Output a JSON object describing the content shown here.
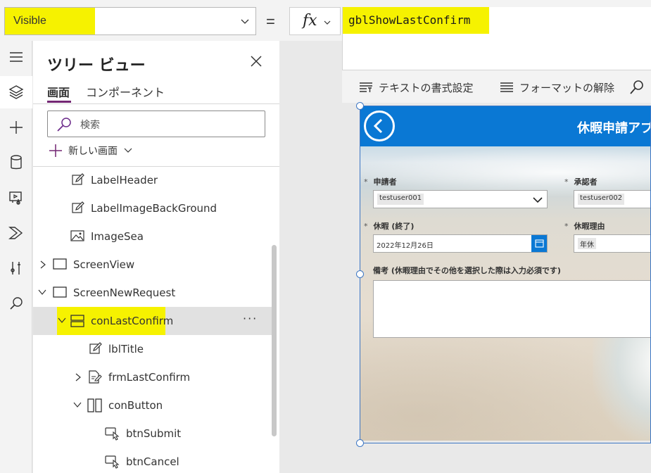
{
  "formula_bar": {
    "property": "Visible",
    "equals": "=",
    "fx": "fx",
    "formula": "gblShowLastConfirm"
  },
  "format_toolbar": {
    "text_format": "テキストの書式設定",
    "remove_format": "フォーマットの解除"
  },
  "rail": {
    "icons": [
      "hamburger-icon",
      "layers-icon",
      "plus-icon",
      "data-icon",
      "media-icon",
      "power-automate-icon",
      "tools-icon",
      "search-icon"
    ]
  },
  "tree": {
    "title": "ツリー ビュー",
    "tabs": [
      {
        "label": "画面",
        "active": true
      },
      {
        "label": "コンポーネント",
        "active": false
      }
    ],
    "search_placeholder": "検索",
    "new_screen": "新しい画面",
    "nodes": [
      {
        "label": "LabelHeader",
        "icon": "label-icon"
      },
      {
        "label": "LabelImageBackGround",
        "icon": "label-icon"
      },
      {
        "label": "ImageSea",
        "icon": "image-icon"
      },
      {
        "label": "ScreenView",
        "icon": "screen-icon",
        "expander": "collapsed"
      },
      {
        "label": "ScreenNewRequest",
        "icon": "screen-icon",
        "expander": "expanded"
      },
      {
        "label": "conLastConfirm",
        "icon": "vertical-container-icon",
        "expander": "expanded",
        "selected": true,
        "more": "···"
      },
      {
        "label": "lblTitle",
        "icon": "label-icon"
      },
      {
        "label": "frmLastConfirm",
        "icon": "form-icon",
        "expander": "collapsed"
      },
      {
        "label": "conButton",
        "icon": "horizontal-container-icon",
        "expander": "expanded"
      },
      {
        "label": "btnSubmit",
        "icon": "button-icon"
      },
      {
        "label": "btnCancel",
        "icon": "button-icon"
      }
    ]
  },
  "app": {
    "header_title": "休暇申請アプ",
    "fields": {
      "requester_label": "申請者",
      "requester_value": "testuser001",
      "approver_label": "承認者",
      "approver_value": "testuser002",
      "leave_end_label": "休暇 (終了)",
      "leave_end_value": "2022年12月26日",
      "reason_label": "休暇理由",
      "reason_value": "年休",
      "notes_label": "備考 (休暇理由でその他を選択した際は入力必須です)",
      "required_mark": "*"
    }
  },
  "colors": {
    "highlight": "#f6f200",
    "app_header": "#0a78d4",
    "tab_accent": "#742774",
    "selection": "#3c76c4"
  }
}
